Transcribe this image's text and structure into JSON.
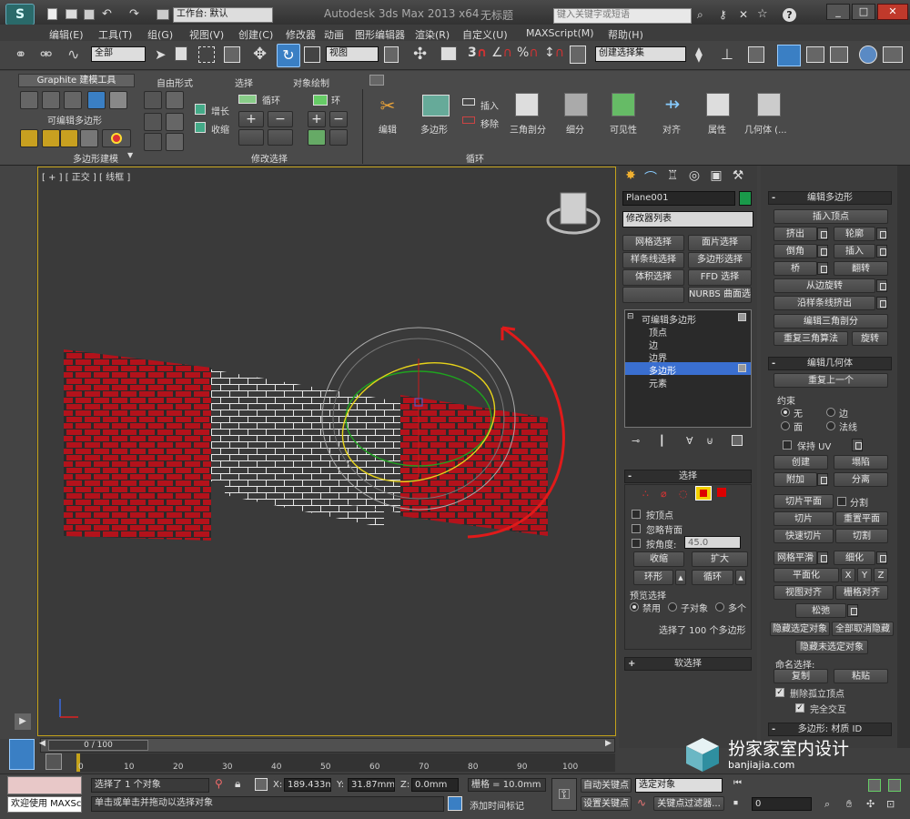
{
  "titlebar": {
    "workspace_label": "工作台: 默认",
    "app_title": "Autodesk 3ds Max  2013 x64",
    "doc_title": "无标题",
    "search_placeholder": "键入关键字或短语"
  },
  "menu": [
    "编辑(E)",
    "工具(T)",
    "组(G)",
    "视图(V)",
    "创建(C)",
    "修改器",
    "动画",
    "图形编辑器",
    "渲染(R)",
    "自定义(U)",
    "MAXScript(M)",
    "帮助(H)"
  ],
  "toolbar": {
    "selection_filter": "全部",
    "reference_coord": "视图",
    "named_selection_set": "创建选择集"
  },
  "ribbon": {
    "tabs": [
      "Graphite 建模工具",
      "自由形式",
      "选择",
      "对象绘制"
    ],
    "panel_label_edit_poly": "可编辑多边形",
    "grow": "增长",
    "shrink": "收缩",
    "loop": "循环",
    "ring": "环",
    "insert": "插入",
    "remove": "移除",
    "big_buttons": [
      "编辑",
      "多边形",
      "三角剖分",
      "细分",
      "可见性",
      "对齐",
      "属性",
      "几何体 (..."
    ],
    "footer_poly_modeling": "多边形建模",
    "footer_modify_selection": "修改选择",
    "footer_loop": "循环"
  },
  "viewport": {
    "label": "[ + ] [ 正交 ] [ 线框 ]"
  },
  "command_panel": {
    "object_name": "Plane001",
    "object_color": "#1a9a4a",
    "modifier_list": "修改器列表",
    "modifier_buttons": [
      "网格选择",
      "面片选择",
      "样条线选择",
      "多边形选择",
      "体积选择",
      "FFD 选择",
      "",
      "NURBS 曲面选择"
    ],
    "stack": [
      "可编辑多边形",
      "顶点",
      "边",
      "边界",
      "多边形",
      "元素"
    ],
    "selection": {
      "title": "选择",
      "by_vertex": "按顶点",
      "ignore_backfacing": "忽略背面",
      "by_angle": "按角度:",
      "angle_value": "45.0",
      "shrink": "收缩",
      "grow": "扩大",
      "ring": "环形",
      "loop": "循环",
      "preview_label": "预览选择",
      "disabled": "禁用",
      "subobject": "子对象",
      "multi": "多个",
      "status": "选择了 100 个多边形"
    },
    "soft_selection": "软选择"
  },
  "right_panel": {
    "edit_poly_title": "编辑多边形",
    "insert_vertex": "插入顶点",
    "extrude": "挤出",
    "outline": "轮廓",
    "bevel": "倒角",
    "inset": "插入",
    "bridge": "桥",
    "flip": "翻转",
    "hinge_from_edge": "从边旋转",
    "extrude_along_spline": "沿样条线挤出",
    "edit_triangulation": "编辑三角剖分",
    "retriangulate": "重复三角算法",
    "turn": "旋转",
    "edit_geometry_title": "编辑几何体",
    "repeat_last": "重复上一个",
    "constraints": "约束",
    "c_none": "无",
    "c_edge": "边",
    "c_face": "面",
    "c_normal": "法线",
    "preserve_uv": "保持 UV",
    "create": "创建",
    "collapse": "塌陷",
    "attach": "附加",
    "detach": "分离",
    "slice_plane": "切片平面",
    "split": "分割",
    "slice": "切片",
    "reset_plane": "重置平面",
    "quickslice": "快速切片",
    "cut": "切割",
    "meshsmooth": "网格平滑",
    "tessellate": "细化",
    "make_planar": "平面化",
    "x": "X",
    "y": "Y",
    "z": "Z",
    "view_align": "视图对齐",
    "grid_align": "栅格对齐",
    "relax": "松弛",
    "hide_selected": "隐藏选定对象",
    "unhide_all": "全部取消隐藏",
    "hide_unselected": "隐藏未选定对象",
    "named_selections": "命名选择:",
    "copy": "复制",
    "paste": "粘贴",
    "delete_isolated": "删除孤立顶点",
    "full_interactivity": "完全交互",
    "material_id_title": "多边形: 材质 ID"
  },
  "timeline": {
    "frame": "0 / 100",
    "ticks": [
      "0",
      "10",
      "20",
      "30",
      "40",
      "50",
      "60",
      "70",
      "80",
      "90",
      "100"
    ]
  },
  "statusbar": {
    "maxscript_label": "欢迎使用 MAXSc",
    "selected": "选择了 1 个对象",
    "hint": "单击或单击并拖动以选择对象",
    "x_label": "X:",
    "x_value": "189.433mm",
    "y_label": "Y:",
    "y_value": "31.87mm",
    "z_label": "Z:",
    "z_value": "0.0mm",
    "grid": "栅格 = 10.0mm",
    "add_time_tag": "添加时间标记",
    "auto_key": "自动关键点",
    "set_key": "设置关键点",
    "selected_set": "选定对象",
    "key_filters": "关键点过滤器...",
    "frame_value": "0"
  },
  "watermark": {
    "title": "扮家家室内设计",
    "url": "banjiajia.com"
  }
}
